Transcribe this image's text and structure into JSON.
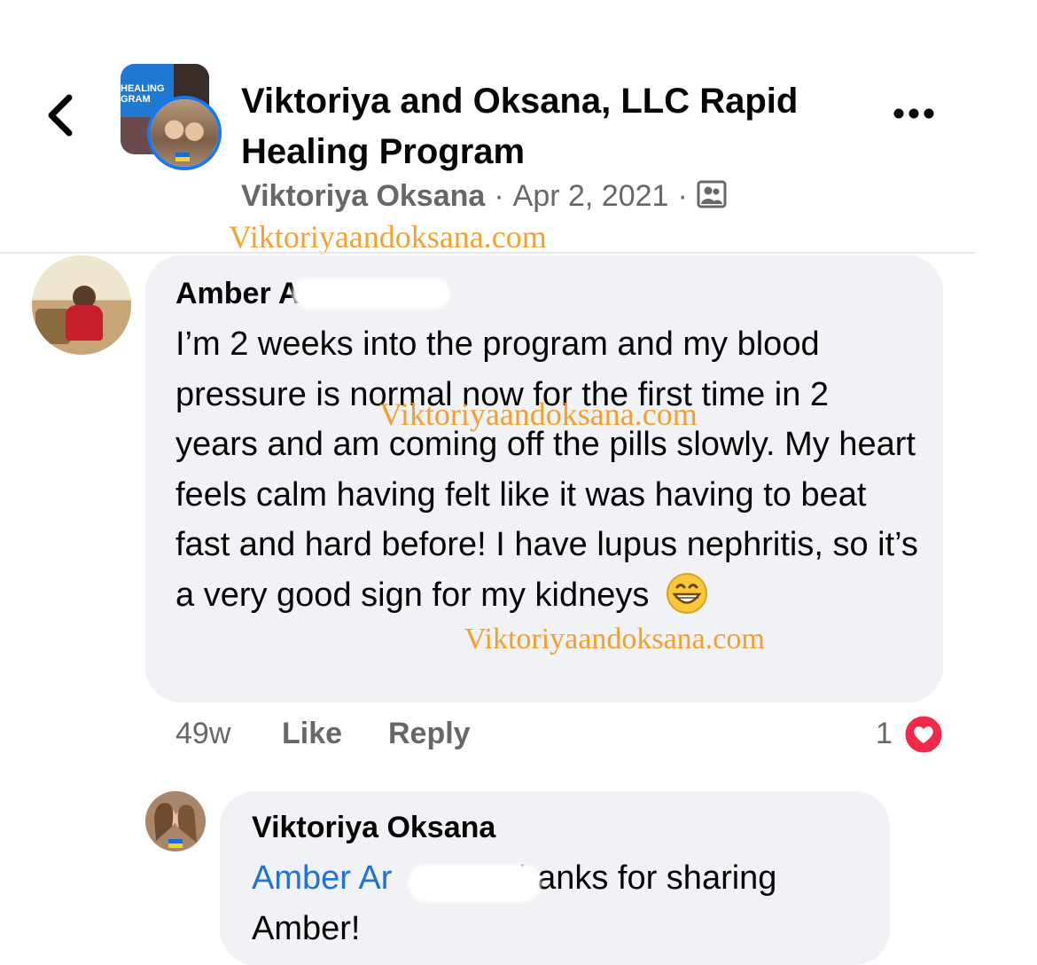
{
  "header": {
    "title": "Viktoriya and Oksana, LLC Rapid Healing Program",
    "author": "Viktoriya Oksana",
    "separator": "·",
    "date": "Apr 2, 2021",
    "group_avatar_text": [
      "HEALING",
      "GRAM"
    ],
    "icons": [
      "back-chevron-icon",
      "more-options-icon",
      "members-privacy-icon"
    ]
  },
  "watermark": "Viktoriyaandoksana.com",
  "comment1": {
    "name": "Amber A",
    "text": "I’m 2 weeks into the program and my blood pressure is normal now for the first time in 2 years and am coming off the pills slowly. My heart feels calm having felt like it was having to beat fast and hard before! I have lupus nephritis, so it’s a very good sign for my kidneys",
    "emoji": "grinning-face-icon",
    "time": "49w",
    "like": "Like",
    "reply": "Reply",
    "reaction_count": "1",
    "reaction_icon": "heart-icon"
  },
  "comment2": {
    "name": "Viktoriya Oksana",
    "mention": "Amber Ar",
    "text": "thanks for sharing Amber!"
  },
  "colors": {
    "accent": "#1877f2",
    "mention": "#2171d6",
    "bubble": "#f0f2f5",
    "secondary_text": "#65676b",
    "watermark": "#f29a1f",
    "heart": "#f0284a"
  }
}
